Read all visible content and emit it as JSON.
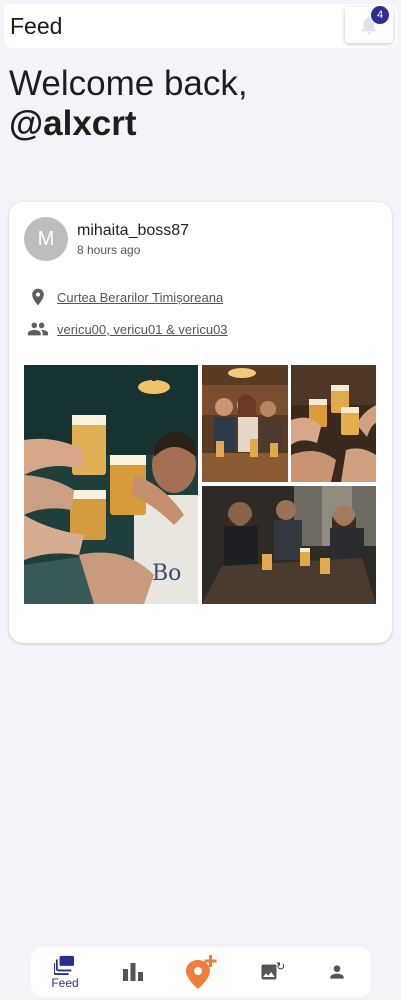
{
  "header": {
    "title": "Feed",
    "notification_count": "4"
  },
  "welcome": {
    "line1": "Welcome back,",
    "username": "@alxcrt"
  },
  "post": {
    "avatar_initial": "M",
    "author": "mihaita_boss87",
    "time": "8 hours ago",
    "location": "Curtea Berarilor Timișoreana",
    "friends": "vericu00, vericu01 & vericu03",
    "photos": [
      "cheers-photo",
      "friends-at-bar-photo",
      "toast-photo",
      "group-at-table-photo"
    ]
  },
  "nav": {
    "feed_label": "Feed",
    "active_color": "#2c2f8f",
    "accent_color": "#ef7d3c",
    "items": [
      "feed",
      "stats",
      "add-location",
      "gallery",
      "profile"
    ]
  }
}
